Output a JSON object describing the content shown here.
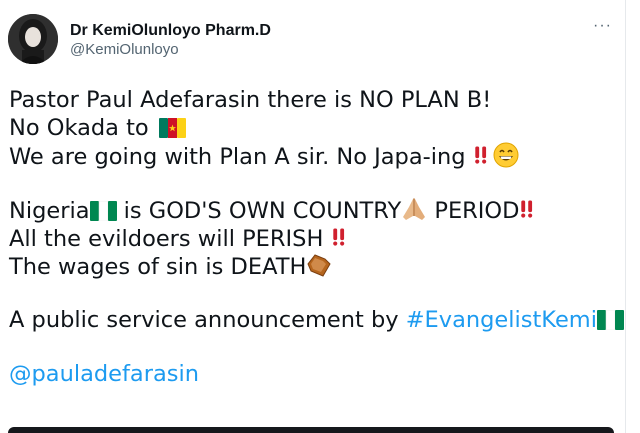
{
  "author": {
    "display_name": "Dr KemiOlunloyo Pharm.D",
    "handle": "@KemiOlunloyo"
  },
  "more_button": "···",
  "tweet": {
    "line1": "Pastor Paul Adefarasin there is NO PLAN B!",
    "line2_text": "No Okada to ",
    "line3_text": "We are going with Plan A sir. No Japa-ing",
    "line4_a": "Nigeria",
    "line4_b": " is GOD'S OWN COUNTRY",
    "line4_c": " PERIOD",
    "line5": "All the evildoers will PERISH",
    "line6": "The wages of sin is DEATH",
    "line7_text": "A public service announcement by ",
    "hashtag": "#EvangelistKemi",
    "mention": "@pauladefarasin"
  },
  "icons": {
    "flag_cameroon": "cameroon-flag-icon",
    "flag_nigeria": "nigeria-flag-icon",
    "double_exclamation": "double-exclamation-icon",
    "grin": "grinning-face-icon",
    "praying_hands": "folded-hands-icon",
    "coffin": "coffin-icon"
  },
  "colors": {
    "link": "#1d9bf0",
    "text": "#0f1419",
    "muted": "#536471",
    "exclaim": "#d0202e",
    "nigeria_green": "#008751",
    "cameroon_green": "#007a5e",
    "cameroon_red": "#ce1126",
    "cameroon_yellow": "#fcd116"
  }
}
